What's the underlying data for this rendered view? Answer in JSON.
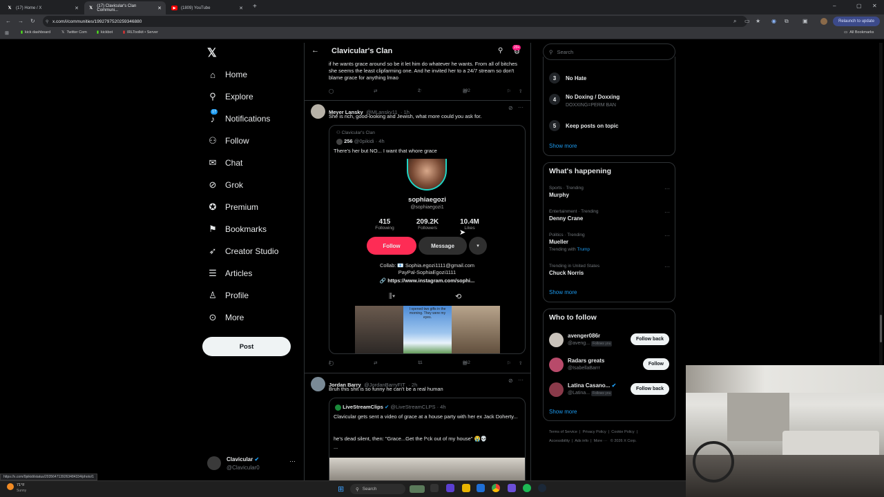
{
  "browser": {
    "tabs": [
      {
        "title": "(17) Home / X"
      },
      {
        "title": "(17) Clavicular's Clan Communi..."
      },
      {
        "title": "(1809) YouTube"
      }
    ],
    "url": "x.com/i/communities/1992797520259346880",
    "relaunch_label": "Relaunch to update",
    "bookmarks": [
      "kick dashboard",
      "Twitter Com",
      "kickbot",
      "IRLToolkit • Server"
    ],
    "all_bookmarks": "All Bookmarks"
  },
  "nav": {
    "items": [
      {
        "label": "Home",
        "icon": "home-icon"
      },
      {
        "label": "Explore",
        "icon": "search-icon"
      },
      {
        "label": "Notifications",
        "icon": "bell-icon",
        "badge": "17"
      },
      {
        "label": "Follow",
        "icon": "person-plus-icon"
      },
      {
        "label": "Chat",
        "icon": "mail-icon"
      },
      {
        "label": "Grok",
        "icon": "grok-icon"
      },
      {
        "label": "Premium",
        "icon": "verified-icon"
      },
      {
        "label": "Bookmarks",
        "icon": "bookmark-icon"
      },
      {
        "label": "Creator Studio",
        "icon": "rocket-icon"
      },
      {
        "label": "Articles",
        "icon": "article-icon"
      },
      {
        "label": "Profile",
        "icon": "person-icon"
      },
      {
        "label": "More",
        "icon": "more-circle-icon"
      }
    ],
    "post_label": "Post",
    "account": {
      "name": "Clavicular",
      "handle": "@Clavicular0"
    }
  },
  "header": {
    "title": "Clavicular's Clan",
    "badge": "20+"
  },
  "posts": {
    "top_text": "if he wants grace around so be it let him do whatever he wants. From all of bitches she seems the least clipfarming one. And he invited her to a 24/7 stream so don't blame grace for anything lmao",
    "top_likes": "2",
    "top_views": "392",
    "meyer": {
      "name": "Meyer Lansky",
      "handle": "@MLansky11",
      "time": "· 1h",
      "text": "She is rich, good-looking and Jewish, what more could you ask for.",
      "quote_community": "Clavicular's Clan",
      "quote_name": "256",
      "quote_handle": "@0pikidi",
      "quote_time": "· 4h",
      "quote_text": "There's her but NO... I want that whore grace",
      "profile": {
        "name": "sophiaegozi",
        "handle": "@sophiaegozi1",
        "following": "415",
        "following_label": "Following",
        "followers": "209.2K",
        "followers_label": "Followers",
        "likes": "10.4M",
        "likes_label": "Likes",
        "follow_btn": "Follow",
        "message_btn": "Message",
        "collab": "Collab: 📧 Sophia.egozi1111@gmail.com",
        "paypal": "PayPal-SophiaEgozi1111",
        "link": "https://www.instagram.com/sophi...",
        "video_caption": "I opened two gifts in the morning. They were my eyes."
      },
      "replies": "1",
      "likes": "11",
      "views": "862"
    },
    "jordan": {
      "name": "Jordan Barry",
      "handle": "@JordanBarryFIT",
      "time": "· 2h",
      "text": "Bruh this shit is so funny he can't be a real human",
      "quote_name": "LiveStreamClips",
      "quote_handle": "@LiveStreamCLPS",
      "quote_time": "· 4h",
      "quote_text1": "Clavicular gets sent a video of grace at a house party with her ex Jack Doherty...",
      "quote_text2": "he's dead silent, then: \"Grace...Get the f*ck out of my house\" 😭💀",
      "quote_more": "..."
    }
  },
  "right": {
    "search_placeholder": "Search",
    "rules": [
      {
        "num": "3",
        "title": "No Hate",
        "sub": ""
      },
      {
        "num": "4",
        "title": "No Doxing / Doxxing",
        "sub": "DOXXING=PERM BAN"
      },
      {
        "num": "5",
        "title": "Keep posts on topic",
        "sub": ""
      }
    ],
    "show_more": "Show more",
    "happening_title": "What's happening",
    "trends": [
      {
        "cat": "Sports · Trending",
        "title": "Murphy",
        "extra": ""
      },
      {
        "cat": "Entertainment · Trending",
        "title": "Denny Crane",
        "extra": ""
      },
      {
        "cat": "Politics · Trending",
        "title": "Mueller",
        "extra": "Trending with",
        "extra_link": "Trump"
      },
      {
        "cat": "Trending in United States",
        "title": "Chuck Norris",
        "extra": ""
      }
    ],
    "who_title": "Who to follow",
    "who": [
      {
        "name": "avenger086r",
        "handle": "@aveng...",
        "tag": "Follows you",
        "btn": "Follow back"
      },
      {
        "name": "Radars greats",
        "handle": "@IsabellaBarrr",
        "tag": "",
        "btn": "Follow"
      },
      {
        "name": "Latina Casano...",
        "handle": "@Latina...",
        "tag": "Follows you",
        "btn": "Follow back"
      }
    ],
    "footer1": [
      "Terms of Service",
      "Privacy Policy",
      "Cookie Policy"
    ],
    "footer2": [
      "Accessibility",
      "Ads info",
      "More ···",
      "© 2026 X Corp."
    ]
  },
  "status_url": "https://x.com/0pikidi/status/2035647139263484334/photo/1",
  "taskbar": {
    "weather_temp": "71°F",
    "weather_desc": "Sunny",
    "search": "Search"
  }
}
